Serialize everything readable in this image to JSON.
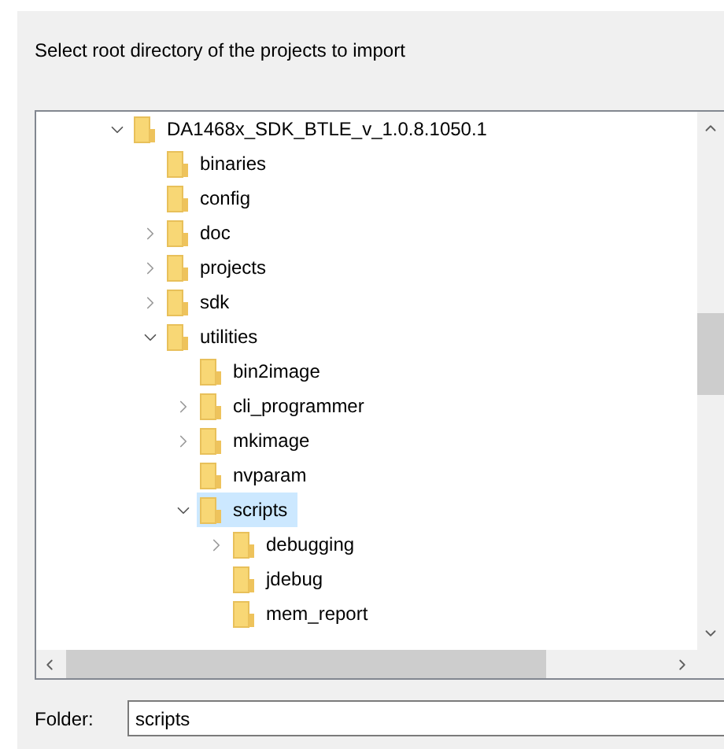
{
  "instruction": "Select root directory of the projects to import",
  "tree": [
    {
      "label": "DA1468x_SDK_BTLE_v_1.0.8.1050.1",
      "expanded": true,
      "selected": false,
      "children": [
        {
          "label": "binaries",
          "selected": false
        },
        {
          "label": "config",
          "selected": false
        },
        {
          "label": "doc",
          "expanded": false,
          "selected": false
        },
        {
          "label": "projects",
          "expanded": false,
          "selected": false
        },
        {
          "label": "sdk",
          "expanded": false,
          "selected": false
        },
        {
          "label": "utilities",
          "expanded": true,
          "selected": false,
          "children": [
            {
              "label": "bin2image",
              "selected": false
            },
            {
              "label": "cli_programmer",
              "expanded": false,
              "selected": false
            },
            {
              "label": "mkimage",
              "expanded": false,
              "selected": false
            },
            {
              "label": "nvparam",
              "selected": false
            },
            {
              "label": "scripts",
              "expanded": true,
              "selected": true,
              "children": [
                {
                  "label": "debugging",
                  "expanded": false,
                  "selected": false
                },
                {
                  "label": "jdebug",
                  "selected": false
                },
                {
                  "label": "mem_report",
                  "selected": false
                }
              ]
            }
          ]
        }
      ]
    }
  ],
  "folder": {
    "label": "Folder:",
    "value": "scripts"
  }
}
